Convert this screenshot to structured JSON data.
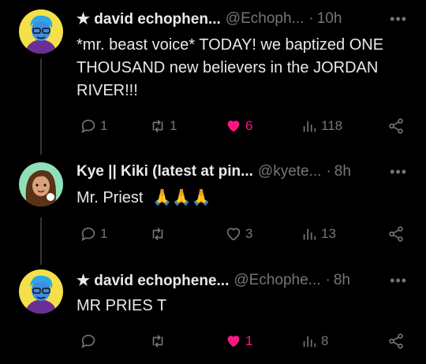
{
  "posts": [
    {
      "name": "★ david echophen...",
      "handle": "@Echoph...",
      "time": "10h",
      "text": "*mr. beast voice* TODAY! we baptized ONE THOUSAND new believers in the JORDAN RIVER!!!",
      "replies": "1",
      "reposts": "1",
      "likes": "6",
      "views": "118",
      "liked": true
    },
    {
      "name": "Kye || Kiki (latest at pin...",
      "handle": "@kyete...",
      "time": "8h",
      "text": "Mr. Priest",
      "emoji": "🙏🙏🙏",
      "replies": "1",
      "reposts": "",
      "likes": "3",
      "views": "13",
      "liked": false
    },
    {
      "name": "★ david echophene...",
      "handle": "@Echophe...",
      "time": "8h",
      "text": "MR PRIES T",
      "replies": "",
      "reposts": "",
      "likes": "1",
      "views": "8",
      "liked": true
    }
  ],
  "colors": {
    "like": "#f91880",
    "muted": "#71767b",
    "text": "#e7e9ea"
  },
  "icons": [
    "reply-icon",
    "repost-icon",
    "heart-icon",
    "views-icon",
    "share-icon",
    "more-icon"
  ]
}
